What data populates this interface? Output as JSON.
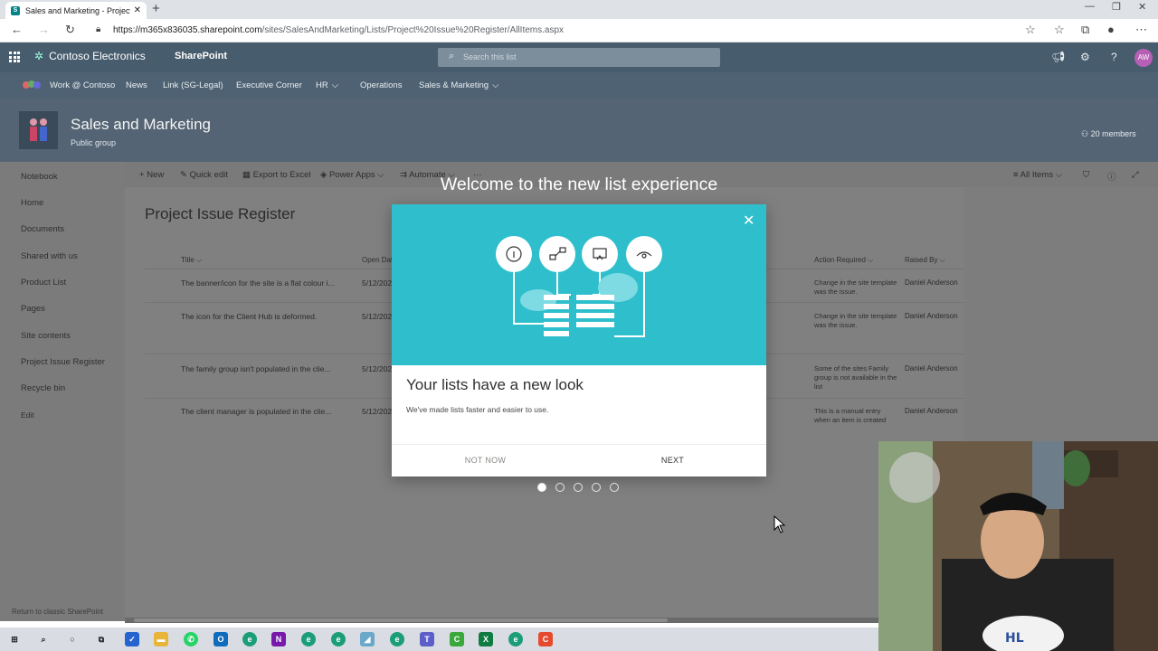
{
  "browser": {
    "tab_title": "Sales and Marketing - Project Iss",
    "new_tab_label": "+",
    "url_prefix": "https://m365x836035.sharepoint.com",
    "url_rest": "/sites/SalesAndMarketing/Lists/Project%20Issue%20Register/AllItems.aspx"
  },
  "suite": {
    "brand": "Contoso Electronics",
    "app": "SharePoint",
    "search_placeholder": "Search this list",
    "avatar_initials": "AW"
  },
  "hubnav": {
    "items": [
      "Work @ Contoso",
      "News",
      "Link (SG-Legal)",
      "Executive Corner",
      "HR",
      "Operations",
      "Sales & Marketing"
    ]
  },
  "site": {
    "title": "Sales and Marketing",
    "subtitle": "Public group",
    "members": "20 members"
  },
  "leftnav": {
    "items": [
      "Notebook",
      "Home",
      "Documents",
      "Shared with us",
      "Product List",
      "Pages",
      "Site contents",
      "Project Issue Register",
      "Recycle bin",
      "Edit"
    ],
    "footer": "Return to classic SharePoint"
  },
  "commands": {
    "new": "New",
    "quick_edit": "Quick edit",
    "export": "Export to Excel",
    "power_apps": "Power Apps",
    "automate": "Automate",
    "more": "···",
    "view": "All Items"
  },
  "list": {
    "title": "Project Issue Register",
    "columns": {
      "title": "Title",
      "open_date": "Open Dat",
      "action": "Action Required",
      "raised_by": "Raised By"
    },
    "rows": [
      {
        "title": "The banner/icon for the site is a flat colour i...",
        "date": "5/12/202",
        "action": "Change in the site template was the issue.",
        "raised_by": "Daniel Anderson"
      },
      {
        "title": "The icon for the Client Hub is deformed.",
        "date": "5/12/202",
        "action": "Change in the site template was the issue.",
        "raised_by": "Daniel Anderson"
      },
      {
        "title": "The family group isn't populated in the clie...",
        "date": "5/12/202",
        "action": "Some of the sites Family group is not available in the list",
        "raised_by": "Daniel Anderson"
      },
      {
        "title": "The client manager is populated in the clie...",
        "date": "5/12/202",
        "action": "This is a manual entry when an item is created",
        "raised_by": "Daniel Anderson"
      }
    ]
  },
  "dialog": {
    "welcome": "Welcome to the new list experience",
    "heading": "Your lists have a new look",
    "body": "We've made lists faster and easier to use.",
    "secondary": "NOT NOW",
    "primary": "NEXT",
    "pages_total": 5,
    "page_current": 1,
    "hero_color": "#2fbfcc"
  },
  "colors": {
    "suite_bar": "#475c6d",
    "hub_nav": "#4f6273",
    "site_header": "#546475"
  }
}
